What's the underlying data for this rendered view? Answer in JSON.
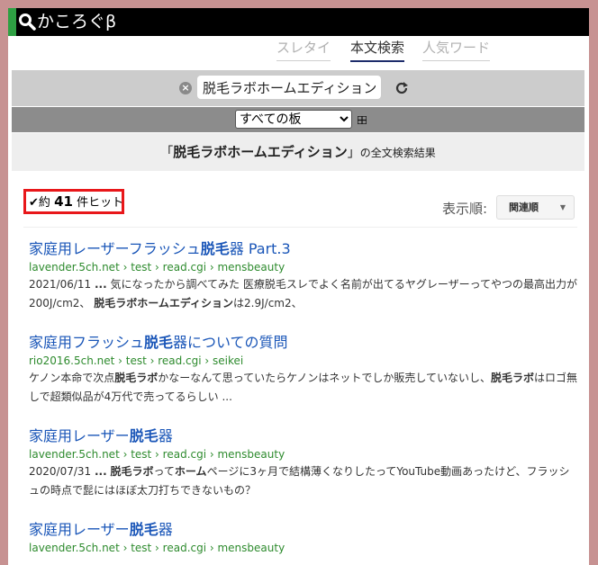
{
  "header": {
    "logo_text": "かころぐβ"
  },
  "tabs": [
    {
      "label": "スレタイ",
      "active": false
    },
    {
      "label": "本文検索",
      "active": true
    },
    {
      "label": "人気ワード",
      "active": false
    }
  ],
  "search": {
    "value": "脱毛ラボホームエディション"
  },
  "board_select": {
    "selected": "すべての板"
  },
  "result_header": {
    "open": "「",
    "query": "脱毛ラボホームエディション",
    "close": "」",
    "suffix": "の全文検索結果"
  },
  "hits": {
    "prefix": "約",
    "count": "41",
    "suffix": "件ヒット"
  },
  "sort": {
    "label": "表示順:",
    "button": "関連順"
  },
  "results": [
    {
      "title_pre": "家庭用レーザーフラッシュ",
      "title_hl": "脱毛",
      "title_post": "器 Part.3",
      "url": "lavender.5ch.net › test › read.cgi › mensbeauty",
      "s1": "2021/06/11 ",
      "s2": "...",
      "s3": " 気になったから調べてみた 医療脱毛スレでよく名前が出てるヤグレーザーってやつの最高出力が200J/cm2、 ",
      "s4": "脱毛ラボホームエディション",
      "s5": "は2.9J/cm2、",
      "s6": "",
      "s7": ""
    },
    {
      "title_pre": "家庭用フラッシュ",
      "title_hl": "脱毛",
      "title_post": "器についての質問",
      "url": "rio2016.5ch.net › test › read.cgi › seikei",
      "s1": "ケノン本命で次点",
      "s2": "脱毛ラボ",
      "s3": "かなーなんて思っていたらケノンはネットでしか販売していないし、",
      "s4": "脱毛ラボ",
      "s5": "はロゴ無しで超類似品が4万代で売ってるらしい ...",
      "s6": "",
      "s7": ""
    },
    {
      "title_pre": "家庭用レーザー",
      "title_hl": "脱毛",
      "title_post": "器",
      "url": "lavender.5ch.net › test › read.cgi › mensbeauty",
      "s1": "2020/07/31 ",
      "s2": "...",
      "s3": " ",
      "s4": "脱毛ラボ",
      "s5": "って",
      "s6": "ホーム",
      "s7": "ページに3ヶ月で結構薄くなりしたってYouTube動画あったけど、フラッシュの時点で髭にはほぼ太刀打ちできないもの？"
    },
    {
      "title_pre": "家庭用レーザー",
      "title_hl": "脱毛",
      "title_post": "器",
      "url": "lavender.5ch.net › test › read.cgi › mensbeauty",
      "s1": "",
      "s2": "",
      "s3": "",
      "s4": "",
      "s5": "",
      "s6": "",
      "s7": ""
    }
  ]
}
